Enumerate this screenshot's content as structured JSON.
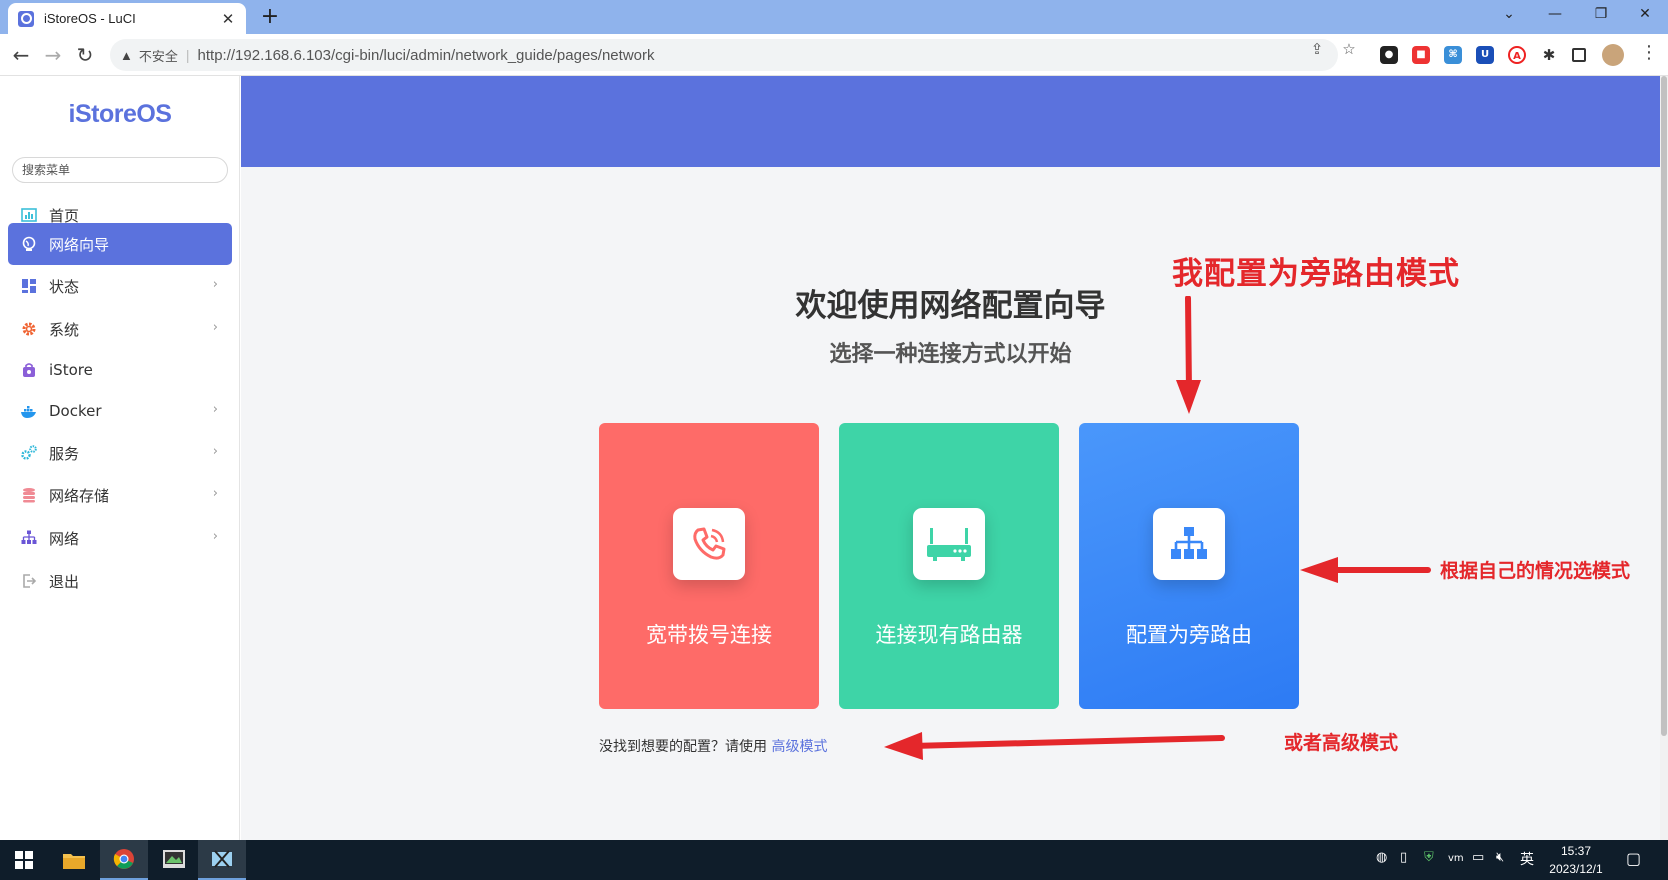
{
  "browser": {
    "tab_title": "iStoreOS - LuCI",
    "security_label": "不安全",
    "url": "http://192.168.6.103/cgi-bin/luci/admin/network_guide/pages/network"
  },
  "sidebar": {
    "logo": "iStoreOS",
    "search_placeholder": "搜索菜单",
    "items": [
      {
        "label": "首页",
        "icon": "dashboard-icon",
        "has_children": false,
        "active": false
      },
      {
        "label": "网络向导",
        "icon": "globe-icon",
        "has_children": false,
        "active": true
      },
      {
        "label": "状态",
        "icon": "grid-icon",
        "has_children": true,
        "active": false
      },
      {
        "label": "系统",
        "icon": "gear-icon",
        "has_children": true,
        "active": false
      },
      {
        "label": "iStore",
        "icon": "bag-icon",
        "has_children": false,
        "active": false
      },
      {
        "label": "Docker",
        "icon": "docker-icon",
        "has_children": true,
        "active": false
      },
      {
        "label": "服务",
        "icon": "gears-icon",
        "has_children": true,
        "active": false
      },
      {
        "label": "网络存储",
        "icon": "database-icon",
        "has_children": true,
        "active": false
      },
      {
        "label": "网络",
        "icon": "sitemap-icon",
        "has_children": true,
        "active": false
      },
      {
        "label": "退出",
        "icon": "logout-icon",
        "has_children": false,
        "active": false
      }
    ]
  },
  "wizard": {
    "title": "欢迎使用网络配置向导",
    "subtitle": "选择一种连接方式以开始",
    "cards": [
      {
        "label": "宽带拨号连接",
        "icon": "phone-icon",
        "color": "#fe6b68"
      },
      {
        "label": "连接现有路由器",
        "icon": "router-icon",
        "color": "#3ed4a7"
      },
      {
        "label": "配置为旁路由",
        "icon": "network-icon",
        "color": "#3a88f8"
      }
    ],
    "footer_text": "没找到想要的配置？请使用",
    "footer_link": "高级模式"
  },
  "annotations": {
    "top": "我配置为旁路由模式",
    "right": "根据自己的情况选模式",
    "bottom": "或者高级模式",
    "color": "#e4272b"
  },
  "taskbar": {
    "ime": "英",
    "time": "15:37",
    "date": "2023/12/1"
  }
}
